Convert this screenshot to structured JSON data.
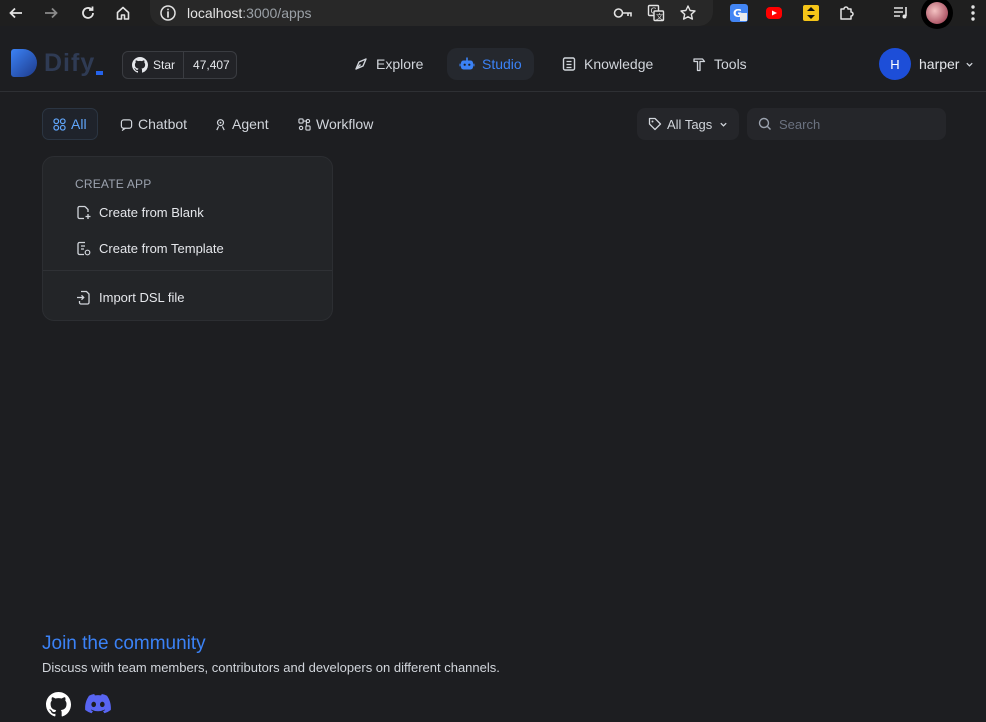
{
  "browser": {
    "url_host": "localhost",
    "url_path": ":3000/apps"
  },
  "header": {
    "logo_text": "Dify",
    "github": {
      "star_label": "Star",
      "star_count": "47,407"
    },
    "nav": [
      {
        "label": "Explore",
        "active": false
      },
      {
        "label": "Studio",
        "active": true
      },
      {
        "label": "Knowledge",
        "active": false
      },
      {
        "label": "Tools",
        "active": false
      }
    ],
    "user": {
      "initial": "H",
      "name": "harper"
    }
  },
  "filters": {
    "tabs": [
      {
        "label": "All",
        "active": true
      },
      {
        "label": "Chatbot",
        "active": false
      },
      {
        "label": "Agent",
        "active": false
      },
      {
        "label": "Workflow",
        "active": false
      }
    ],
    "tags_label": "All Tags",
    "search_placeholder": "Search"
  },
  "create_app": {
    "title": "CREATE APP",
    "blank": "Create from Blank",
    "template": "Create from Template",
    "import": "Import DSL file"
  },
  "community": {
    "title": "Join the community",
    "description": "Discuss with team members, contributors and developers on different channels."
  },
  "colors": {
    "accent": "#3b82f6",
    "background": "#1d1e21",
    "card": "#232528",
    "avatar": "#1d4ed8",
    "discord": "#5865f2"
  }
}
